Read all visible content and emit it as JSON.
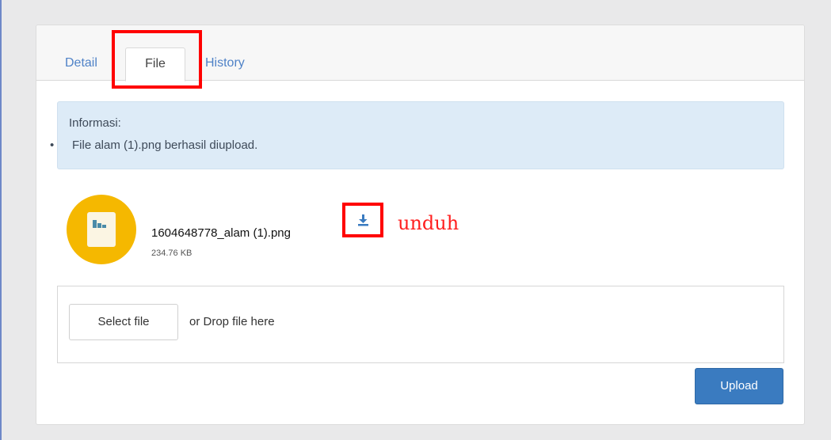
{
  "tabs": [
    {
      "label": "Detail",
      "active": false
    },
    {
      "label": "File",
      "active": true
    },
    {
      "label": "History",
      "active": false
    }
  ],
  "alert": {
    "title": "Informasi:",
    "messages": [
      "File alam (1).png berhasil diupload."
    ]
  },
  "file": {
    "name": "1604648778_alam (1).png",
    "size": "234.76 KB",
    "icon": "image-file-icon"
  },
  "annotation": {
    "download_label": "unduh"
  },
  "upload": {
    "select_label": "Select file",
    "drop_hint": "or Drop file here",
    "upload_label": "Upload"
  },
  "colors": {
    "accent": "#3a7bc0",
    "highlight": "#ff0000",
    "file_icon_bg": "#f5b800",
    "alert_bg": "#ddebf7"
  }
}
